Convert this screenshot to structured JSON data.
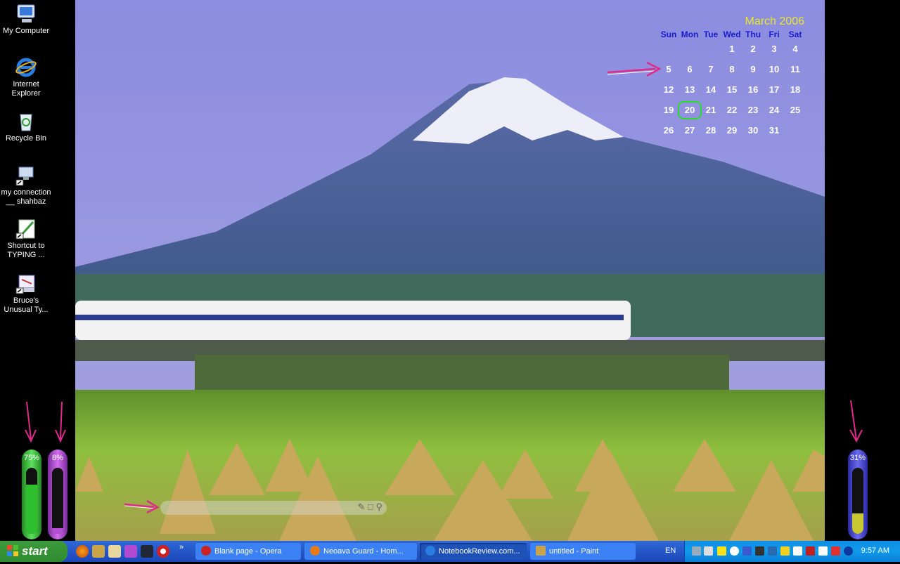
{
  "desktop": {
    "icons": [
      {
        "label": "My Computer"
      },
      {
        "label": "Internet Explorer"
      },
      {
        "label": "Recycle Bin"
      },
      {
        "label": "my connection __ shahbaz"
      },
      {
        "label": "Shortcut to TYPING ..."
      },
      {
        "label": "Bruce's Unusual Ty..."
      }
    ]
  },
  "calendar": {
    "title": "March 2006",
    "weekdays": [
      "Sun",
      "Mon",
      "Tue",
      "Wed",
      "Thu",
      "Fri",
      "Sat"
    ],
    "weeks": [
      [
        "",
        "",
        "",
        "1",
        "2",
        "3",
        "4"
      ],
      [
        "5",
        "6",
        "7",
        "8",
        "9",
        "10",
        "11"
      ],
      [
        "12",
        "13",
        "14",
        "15",
        "16",
        "17",
        "18"
      ],
      [
        "19",
        "20",
        "21",
        "22",
        "23",
        "24",
        "25"
      ],
      [
        "26",
        "27",
        "28",
        "29",
        "30",
        "31",
        ""
      ]
    ],
    "today": "20"
  },
  "gauges": {
    "left_green": {
      "label": "75%",
      "value": 0.75,
      "color": "#2fc02f"
    },
    "left_purple": {
      "label": "8%",
      "value": 0.08,
      "color": "#b64fd6"
    },
    "right_blue": {
      "label": "31%",
      "value": 0.31,
      "color": "#c8c832"
    }
  },
  "searchbar": {
    "placeholder": ""
  },
  "taskbar": {
    "start_label": "start",
    "tasks": [
      {
        "label": "Blank page - Opera",
        "icon_color": "#cc2222"
      },
      {
        "label": "Neoava Guard - Hom...",
        "icon_color": "#e87a1a"
      },
      {
        "label": "NotebookReview.com...",
        "icon_color": "#2a7de0"
      },
      {
        "label": "untitled - Paint",
        "icon_color": "#c9a44a"
      }
    ],
    "language": "EN",
    "clock": "9:57 AM"
  },
  "colors": {
    "taskbar": "#2457c8",
    "tray": "#109ae8",
    "start": "#2f8b2f",
    "calendar_title": "#e8e82a",
    "calendar_weekday": "#1a1acc",
    "today_ring": "#2ddb2d"
  }
}
